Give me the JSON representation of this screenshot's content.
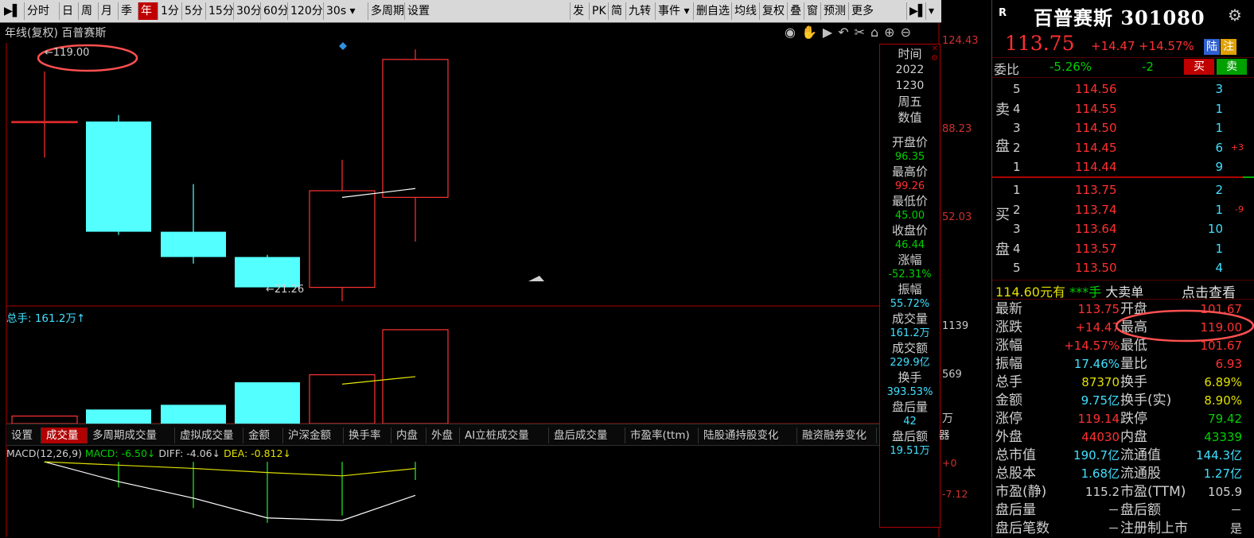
{
  "toolbar": {
    "items": [
      "分时",
      "日",
      "周",
      "月",
      "季",
      "年",
      "1分",
      "5分",
      "15分",
      "30分",
      "60分",
      "120分",
      "30s ▾",
      "多周期",
      "设置"
    ],
    "active_index": 5,
    "right_items": [
      "发",
      "PK",
      "简",
      "九转",
      "事件 ▾",
      "删自选",
      "均线",
      "复权",
      "叠",
      "窗",
      "预测",
      "更多"
    ]
  },
  "chart": {
    "title": "年线(复权)  百普赛斯",
    "axis_prices": [
      "124.43",
      "88.23",
      "52.03"
    ],
    "high_annotation": "119.00",
    "low_annotation": "21.26",
    "candles": [
      {
        "open": 96.35,
        "close": 96.35,
        "high": 119.0,
        "low": 80.0,
        "up": true
      },
      {
        "open": 96.35,
        "close": 46.44,
        "high": 99.26,
        "low": 45.0,
        "up": false
      },
      {
        "open": 46.44,
        "close": 35.0,
        "high": 68.0,
        "low": 32.0,
        "up": false
      },
      {
        "open": 35.0,
        "close": 21.26,
        "high": 36.0,
        "low": 21.26,
        "up": false
      },
      {
        "open": 21.26,
        "close": 65.0,
        "high": 79.0,
        "low": 15.0,
        "up": true
      },
      {
        "open": 62.0,
        "close": 124.43,
        "high": 129.0,
        "low": 42.0,
        "up": true
      }
    ],
    "ma_points": [
      [
        4,
        62
      ],
      [
        5,
        66
      ]
    ],
    "price_range": [
      15.0,
      133.0
    ]
  },
  "volume": {
    "label": "总手: 161.2万↑",
    "axis": [
      "1139",
      "569",
      "万"
    ],
    "bars": [
      {
        "v": 80,
        "up": true
      },
      {
        "v": 150,
        "up": false
      },
      {
        "v": 200,
        "up": false
      },
      {
        "v": 440,
        "up": false
      },
      {
        "v": 520,
        "up": true
      },
      {
        "v": 1000,
        "up": true
      }
    ],
    "max": 1050,
    "ma": [
      [
        4,
        420
      ],
      [
        5,
        500
      ]
    ]
  },
  "vol_tabs": [
    "设置",
    "成交量",
    "多周期成交量",
    "虚拟成交量",
    "金额",
    "沪深金额",
    "换手率",
    "内盘",
    "外盘",
    "AI立桩成交量",
    "盘后成交量",
    "市盈率(ttm)",
    "陆股通持股变化",
    "融资融券变化"
  ],
  "vol_tab_active": 1,
  "vol_tab_tail": "器",
  "macd": {
    "label": "MACD(12,26,9)",
    "macd": "MACD: -6.50↓",
    "diff": "DIFF: -4.06↓",
    "dea": "DEA: -0.812↓",
    "axis": [
      "+0",
      "-7.12"
    ],
    "diff_line": [
      0,
      -2.4,
      -4.4,
      -6.8,
      -7.1,
      -4.06
    ],
    "dea_line": [
      0,
      -0.4,
      -0.8,
      -1.3,
      -1.7,
      -0.812
    ],
    "bars": [
      -0.1,
      -3.1,
      -5.6,
      -7.4,
      -6.5,
      -2.2
    ],
    "range": [
      -7.5,
      0.4
    ]
  },
  "info_panel": {
    "time_label": "时间",
    "year": "2022",
    "date": "1230",
    "weekday": "周五",
    "value_label": "数值",
    "items": [
      {
        "label": "开盘价",
        "value": "96.35",
        "color": "green"
      },
      {
        "label": "最高价",
        "value": "99.26",
        "color": "red"
      },
      {
        "label": "最低价",
        "value": "45.00",
        "color": "green"
      },
      {
        "label": "收盘价",
        "value": "46.44",
        "color": "green"
      },
      {
        "label": "涨幅",
        "value": "-52.31%",
        "color": "green"
      },
      {
        "label": "振幅",
        "value": "55.72%",
        "color": "cyan"
      },
      {
        "label": "成交量",
        "value": "161.2万",
        "color": "cyan"
      },
      {
        "label": "成交额",
        "value": "229.9亿",
        "color": "cyan"
      },
      {
        "label": "换手",
        "value": "393.53%",
        "color": "cyan"
      },
      {
        "label": "盘后量",
        "value": "42",
        "color": "cyan"
      },
      {
        "label": "盘后额",
        "value": "19.51万",
        "color": "cyan"
      }
    ]
  },
  "stock": {
    "badge": "R",
    "name": "百普赛斯",
    "code": "301080",
    "price": "113.75",
    "change": "+14.47",
    "change_pct": "+14.57%",
    "tag1": "陆",
    "tag2": "注",
    "weibi_label": "委比",
    "weibi_pct": "-5.26%",
    "weibi_diff": "-2",
    "sell_btn": "买",
    "buy_btn": "卖",
    "sell_label": [
      "卖",
      "盘"
    ],
    "buy_label": [
      "买",
      "盘"
    ],
    "asks": [
      {
        "lvl": "5",
        "price": "114.56",
        "vol": "3",
        "chg": ""
      },
      {
        "lvl": "4",
        "price": "114.55",
        "vol": "1",
        "chg": ""
      },
      {
        "lvl": "3",
        "price": "114.50",
        "vol": "1",
        "chg": ""
      },
      {
        "lvl": "2",
        "price": "114.45",
        "vol": "6",
        "chg": "+3"
      },
      {
        "lvl": "1",
        "price": "114.44",
        "vol": "9",
        "chg": ""
      }
    ],
    "bids": [
      {
        "lvl": "1",
        "price": "113.75",
        "vol": "2",
        "chg": ""
      },
      {
        "lvl": "2",
        "price": "113.74",
        "vol": "1",
        "chg": "-9"
      },
      {
        "lvl": "3",
        "price": "113.64",
        "vol": "10",
        "chg": ""
      },
      {
        "lvl": "4",
        "price": "113.57",
        "vol": "1",
        "chg": ""
      },
      {
        "lvl": "5",
        "price": "113.50",
        "vol": "4",
        "chg": ""
      }
    ],
    "bigorder": {
      "price": "114.60元有",
      "stars": "***手",
      "label": "大卖单",
      "link": "点击查看"
    },
    "stats": [
      {
        "l1": "最新",
        "v1": "113.75",
        "c1": "red",
        "l2": "开盘",
        "v2": "101.67",
        "c2": "red"
      },
      {
        "l1": "涨跌",
        "v1": "+14.47",
        "c1": "red",
        "l2": "最高",
        "v2": "119.00",
        "c2": "red"
      },
      {
        "l1": "涨幅",
        "v1": "+14.57%",
        "c1": "red",
        "l2": "最低",
        "v2": "101.67",
        "c2": "red"
      },
      {
        "l1": "振幅",
        "v1": "17.46%",
        "c1": "cyan",
        "l2": "量比",
        "v2": "6.93",
        "c2": "red"
      },
      {
        "l1": "总手",
        "v1": "87370",
        "c1": "yellow",
        "l2": "换手",
        "v2": "6.89%",
        "c2": "yellow"
      },
      {
        "l1": "金额",
        "v1": "9.75亿",
        "c1": "cyan",
        "l2": "换手(实)",
        "v2": "8.90%",
        "c2": "yellow"
      },
      {
        "l1": "涨停",
        "v1": "119.14",
        "c1": "red",
        "l2": "跌停",
        "v2": "79.42",
        "c2": "green"
      },
      {
        "l1": "外盘",
        "v1": "44030",
        "c1": "red",
        "l2": "内盘",
        "v2": "43339",
        "c2": "green"
      },
      {
        "l1": "总市值",
        "v1": "190.7亿",
        "c1": "cyan",
        "l2": "流通值",
        "v2": "144.3亿",
        "c2": "cyan"
      },
      {
        "l1": "总股本",
        "v1": "1.68亿",
        "c1": "cyan",
        "l2": "流通股",
        "v2": "1.27亿",
        "c2": "cyan"
      },
      {
        "l1": "市盈(静)",
        "v1": "115.2",
        "c1": "white",
        "l2": "市盈(TTM)",
        "v2": "105.9",
        "c2": "white"
      },
      {
        "l1": "盘后量",
        "v1": "－",
        "c1": "white",
        "l2": "盘后额",
        "v2": "－",
        "c2": "white"
      },
      {
        "l1": "盘后笔数",
        "v1": "－",
        "c1": "white",
        "l2": "注册制上市",
        "v2": "是",
        "c2": "white"
      }
    ]
  },
  "colors": {
    "up": "#ff3232",
    "down": "#54ffff",
    "ma_white": "#ffffff",
    "ma_yellow": "#e6e600",
    "accent": "#c00000"
  }
}
